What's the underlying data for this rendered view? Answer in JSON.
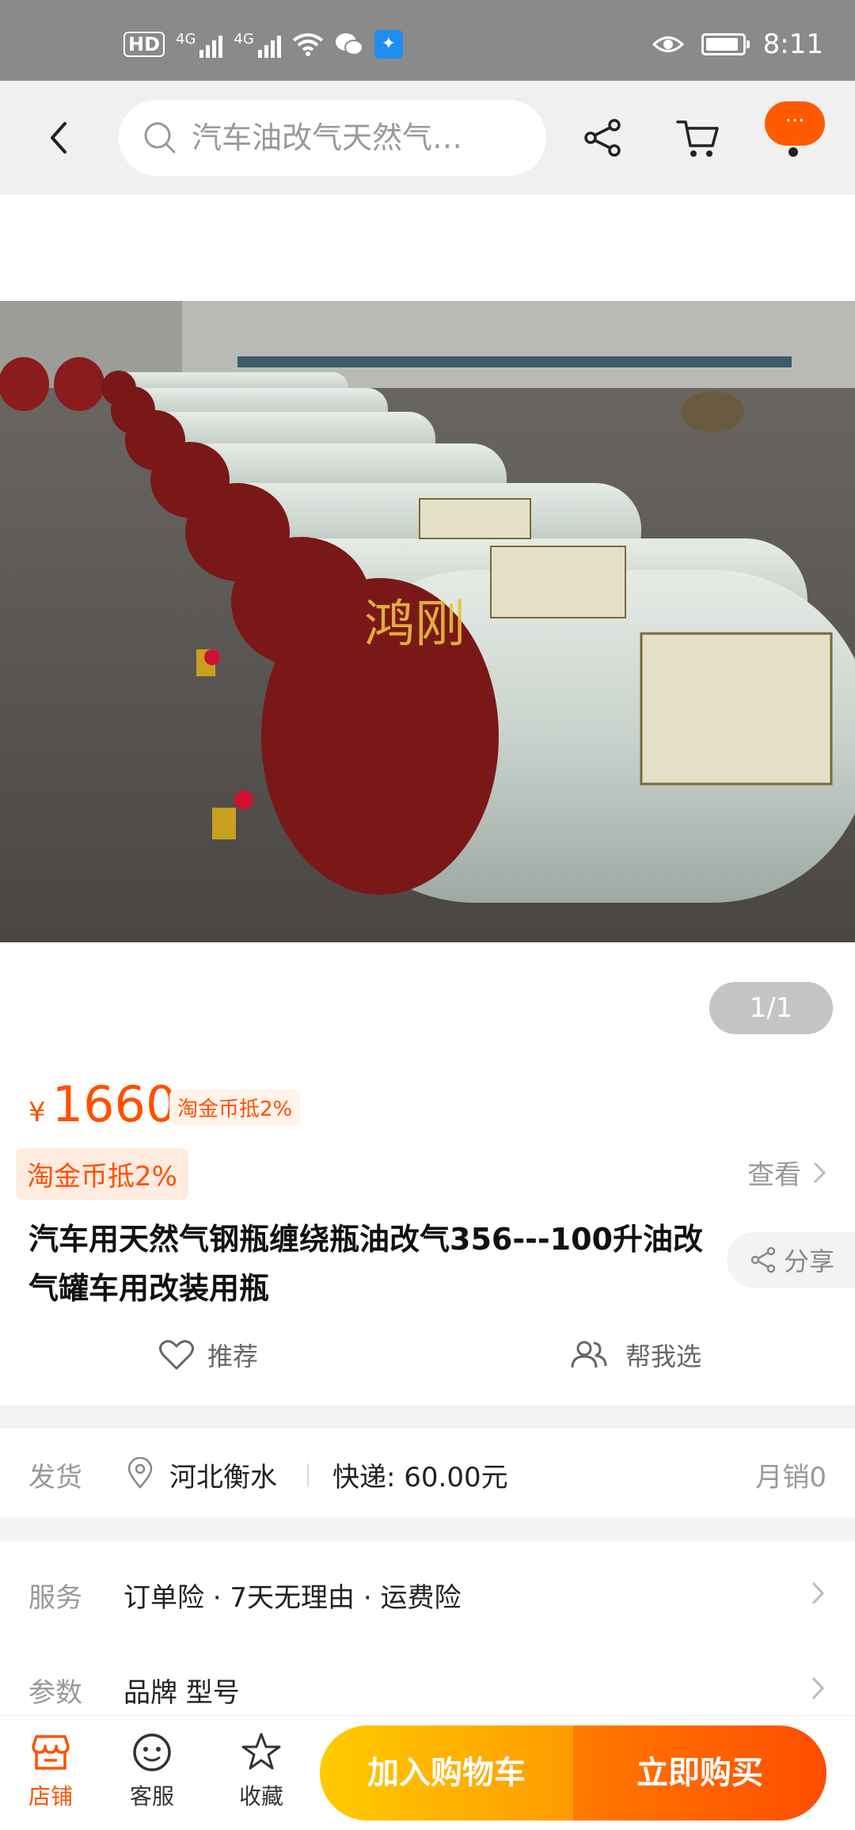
{
  "status_bar": {
    "hd": "HD",
    "sim1": "4G",
    "sim2": "4G",
    "time": "8:11"
  },
  "nav": {
    "search_text": "汽车油改气天然气…",
    "more_label": "···"
  },
  "gallery": {
    "watermark": "鸿刚",
    "counter": "1/1"
  },
  "product": {
    "currency": "¥",
    "price": "1660",
    "coupon_tag": "淘金币抵2%",
    "coupon_block": "淘金币抵2%",
    "view_more": "查看",
    "title": "汽车用天然气钢瓶缠绕瓶油改气356---100升油改气罐车用改装用瓶",
    "share": "分享",
    "recommend": "推荐",
    "help_choose": "帮我选"
  },
  "shipping": {
    "label": "发货",
    "location": "河北衡水",
    "fee": "快递: 60.00元",
    "monthly_sales": "月销0"
  },
  "service": {
    "label": "服务",
    "value": "订单险 · 7天无理由 · 运费险"
  },
  "params": {
    "label": "参数",
    "value": "品牌 型号"
  },
  "bottom_bar": {
    "store": "店铺",
    "customer_service": "客服",
    "favorite": "收藏",
    "add_to_cart": "加入购物车",
    "buy_now": "立即购买"
  },
  "colors": {
    "accent": "#ff5000",
    "cart_button": "#ffa000",
    "buy_button": "#ff5a00"
  }
}
